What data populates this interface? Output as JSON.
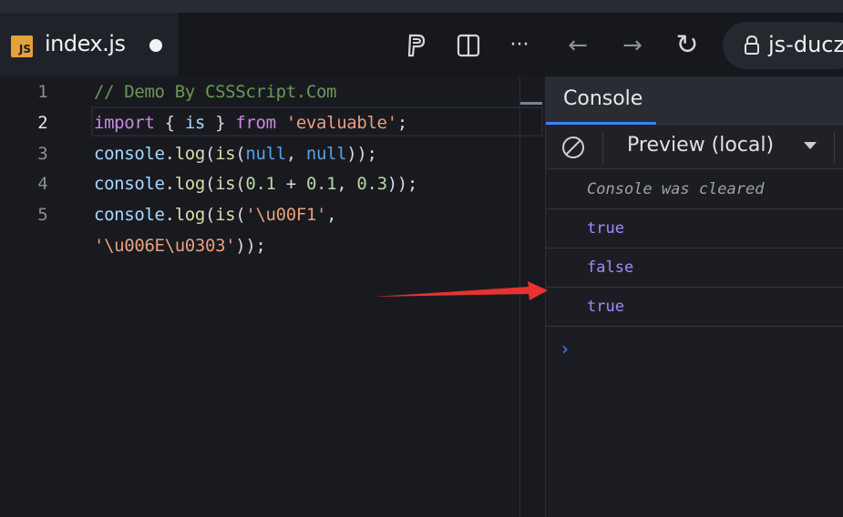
{
  "tab": {
    "badge": "JS",
    "filename": "index.js"
  },
  "toolbar": {
    "p_icon": "paypal-p-icon",
    "split_icon": "split-view-icon",
    "more": "···",
    "back": "←",
    "forward": "→",
    "reload": "↻"
  },
  "address": {
    "url": "js-ducz"
  },
  "editor": {
    "line_numbers": [
      "1",
      "2",
      "3",
      "4",
      "5"
    ],
    "active_line": "2"
  },
  "console": {
    "tab_label": "Console",
    "source": "Preview (local)",
    "messages": [
      "Console was cleared",
      "true",
      "false",
      "true"
    ],
    "prompt": "›"
  },
  "colors": {
    "accent": "#3b82f6",
    "annotation_arrow": "#e8322f",
    "js_badge": "#e5a13a"
  }
}
